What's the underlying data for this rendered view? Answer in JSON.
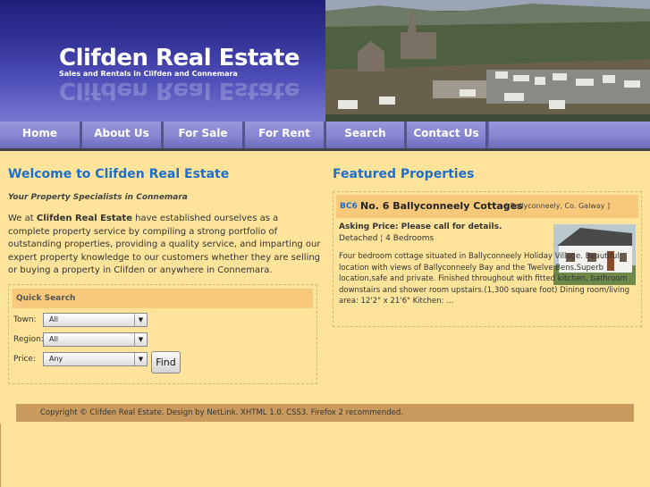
{
  "brand": {
    "title": "Clifden Real Estate",
    "subtitle": "Sales and Rentals in Clifden and Connemara",
    "reflection": "Clifden Real Estate"
  },
  "nav": [
    "Home",
    "About Us",
    "For Sale",
    "For Rent",
    "Search",
    "Contact Us"
  ],
  "welcome": {
    "heading": "Welcome to Clifden Real Estate",
    "tagline": "Your Property Specialists in Connemara",
    "intro_prefix": "We at ",
    "intro_bold": "Clifden Real Estate",
    "intro_rest": " have established ourselves as a complete property service by compiling a strong portfolio of outstanding properties, providing a quality service, and imparting our expert property knowledge to our customers whether they are selling or buying a property in Clifden or anywhere in Connemara."
  },
  "quick_search": {
    "heading": "Quick Search",
    "town_label": "Town:",
    "town_value": "All",
    "region_label": "Region:",
    "region_value": "All",
    "price_label": "Price:",
    "price_value": "Any",
    "find_label": "Find"
  },
  "featured": {
    "heading": "Featured Properties",
    "code": "BC6",
    "name": "No. 6 Ballyconneely Cottages",
    "location": "[ Ballyconneely, Co. Galway ]",
    "price": "Asking Price: Please call for details.",
    "type": "Detached ¦ 4 Bedrooms",
    "description": "Four bedroom cottage situated in Ballyconneely Holiday Village. Beautiful location with views of Ballyconneely Bay and the Twelve Bens.Superb location,safe and private. Finished throughout with fitted kitchen, bathroom downstairs and shower room upstairs.(1,300 square foot) Dining room/living area: 12'2\" x 21'6\" Kitchen: ..."
  },
  "footer": "Copyright © Clifden Real Estate. Design by NetLink. XHTML 1.0. CSS3. Firefox 2 recommended."
}
